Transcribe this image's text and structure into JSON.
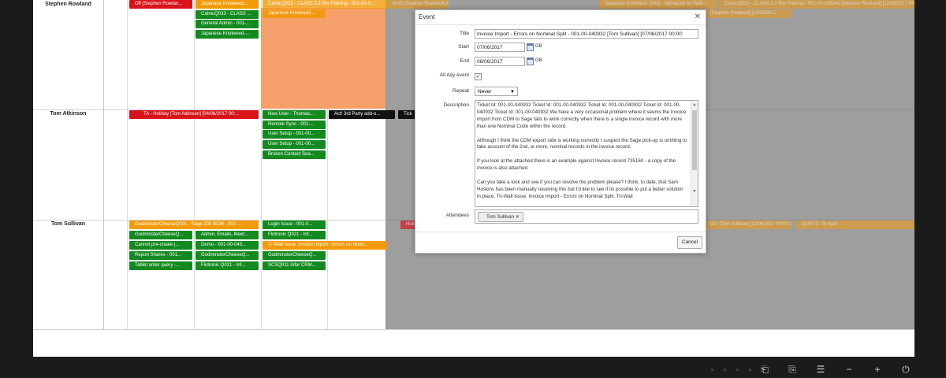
{
  "rows": [
    {
      "name": "Stephen Rowland"
    },
    {
      "name": "Tom Atkinson"
    },
    {
      "name": "Tom Sullivan"
    }
  ],
  "events": {
    "e1": "Off [Stephen Rowlan...",
    "e2": "Japanese Knotweed...",
    "e3": "CatnicQ033 - CLASS ...",
    "e4": "General Admin - 001-...",
    "e5": "Japanese Knotweed-...",
    "e6": "Japanese Knotweed...",
    "e7": "CatnicQ033 - CLASS 3.2 Pre Filtering - 001-00-0...",
    "e8": "8040 [Stephen Rowland] [6...",
    "e9": "Japanese Knotweed Q002 - AlphaLink for Web ...",
    "e10": "CatnicQ033 - CLASS 3.2 Pre Filtering - 001-00-038340 [Stephen Rowland] [12/06/2017 00:00:00]",
    "e11": "[Stephen Rowland] [12/06/2017",
    "e12": "TA - Holiday [Tom Atkinson] [04/06/2017 00:...",
    "e13": "New User - Thomas...",
    "e14": "Act! 3rd Party add-o...",
    "e15": "Tick",
    "e16": "Remote Sync - 001-...",
    "e17": "User Setup - 001-00...",
    "e18": "User Setup - 001-00...",
    "e19": "Broken Contact Sea...",
    "e20": "GodminsterCheeseQ001 - Sage 200 BOM - 001-...",
    "e21": "Login Issue - 001-0...",
    "e22": "Holi",
    "e23": "GodminsterCheeseQ...",
    "e24": "Admin, Emails, Meet...",
    "e25": "Flotronic Q021 - Inf...",
    "e26": "Cannot pre-create j...",
    "e27": "Demo - 001-00-040...",
    "e28": "Tr-Wall Issue: Invoice Import - Errors on Nomi...",
    "e29": "Report Shares - 001...",
    "e30": "GodminsterCheeseQ...",
    "e31": "GodminsterCheeseQ...",
    "e32": "Tablet order query -...",
    "e33": "Flotronic Q021 - Inf...",
    "e34": "SCSQ011 Infor CRM...",
    "e35": "027 [Tom Sullivan] [12/06/2017 00:00:00]",
    "e36": "QUOTE: Tri-Wall - ..."
  },
  "modal": {
    "title": "Event",
    "labels": {
      "title": "Title",
      "start": "Start",
      "end": "End",
      "all_day": "All day event",
      "repeat": "Repeat",
      "description": "Description",
      "attendees": "Attendees"
    },
    "title_value": "Invoice Import - Errors on Nominal Split - 001-00-040932 [Tom Sullivan] [07/06/2017 00:00:",
    "start_value": "07/06/2017",
    "end_value": "08/06/2017",
    "gb": "GB",
    "all_day_checked": true,
    "repeat_value": "Never",
    "description": [
      "Ticket Id: 001-00-040932 Ticket Id: 001-00-040932 Ticket Id: 001-00-040932 Ticket Id: 001-00-040932 Ticket Id: 001-00-040932 We have a very occasional problem where it seems the Invoice import from CDM to Sage fails to work correctly when there is a single invoice record with more than one Nominal Code within the record.",
      "Although I think the CDM export side is working correctly I suspect the Sage pick-up is omitting to take account of the 2nd, or more, nominal records in the invoice record.",
      "If you look at the attached there is an example against Invoice record 735160 - a copy of the invoice is also attached.",
      "Can you take a look and see if you can resolve the problem please? I think, to date, that Sam Hoskins has been manually resolving this but I'd like to see if its possible to put a better solution in place.  Tri-Wall Issue: Invoice Import - Errors on Nominal Split. Tri-Wall"
    ],
    "attendee": "Tom Sullivan",
    "cancel_label": "Cancel"
  },
  "colors": {
    "green": "#138a1f",
    "red": "#d9131a",
    "orange": "#f39a0a",
    "black": "#111111",
    "orange_block": "#f5a06a"
  },
  "icons": [
    "monitor-input-icon",
    "monitor-output-icon",
    "menu-icon",
    "minus-icon",
    "plus-icon",
    "power-icon"
  ]
}
